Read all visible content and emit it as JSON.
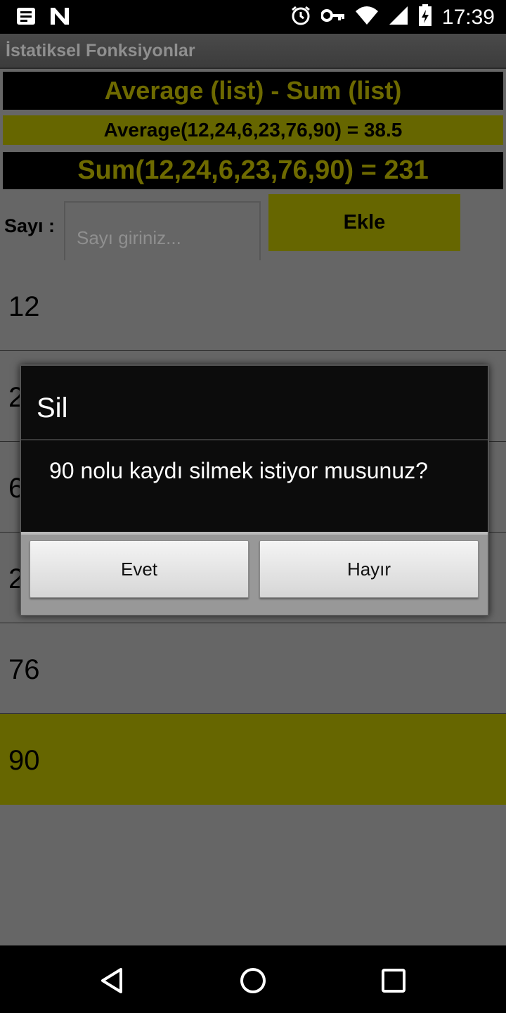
{
  "status_bar": {
    "time": "17:39",
    "left_icons": [
      "notification-icon",
      "n-app-icon"
    ],
    "right_icons": [
      "alarm-icon",
      "vpn-key-icon",
      "wifi-icon",
      "signal-icon",
      "battery-icon"
    ]
  },
  "app": {
    "title": "İstatiksel Fonksiyonlar",
    "header_title": "Average (list) - Sum (list)",
    "average_result": "Average(12,24,6,23,76,90) = 38.5",
    "sum_result": "Sum(12,24,6,23,76,90) = 231",
    "input_label": "Sayı :",
    "input_placeholder": "Sayı giriniz...",
    "input_value": "",
    "add_button": "Ekle",
    "items": [
      "12",
      "24",
      "6",
      "23",
      "76",
      "90"
    ],
    "selected_item": "90"
  },
  "dialog": {
    "title": "Sil",
    "message": "90 nolu kaydı silmek istiyor musunuz?",
    "positive_button": "Evet",
    "negative_button": "Hayır"
  },
  "colors": {
    "accent": "#666600",
    "accent_text": "#6e6a00",
    "background": "#666666"
  }
}
